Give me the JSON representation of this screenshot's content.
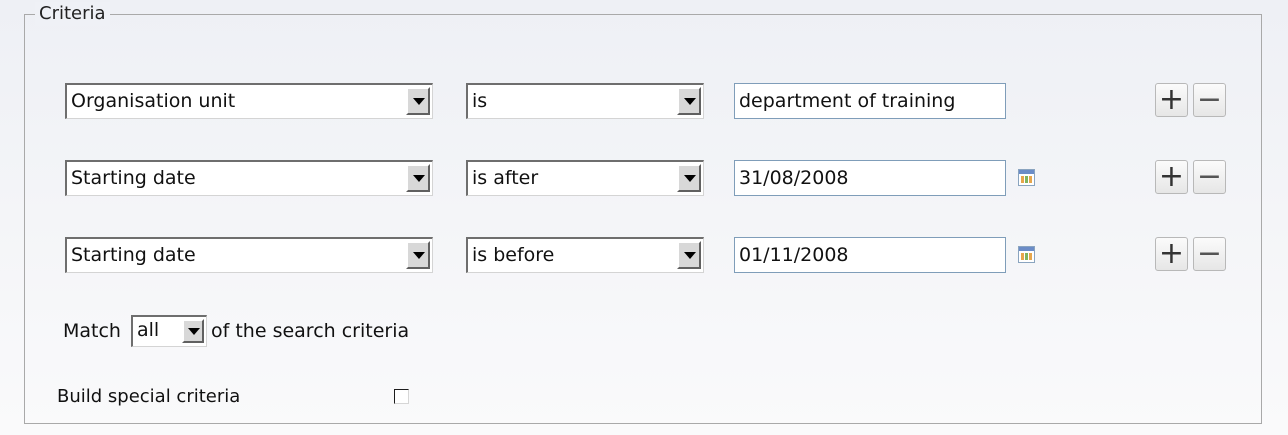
{
  "section": {
    "legend": "Criteria"
  },
  "rows": [
    {
      "field": "Organisation unit",
      "operator": "is",
      "value": "department of training",
      "has_calendar": false
    },
    {
      "field": "Starting date",
      "operator": "is after",
      "value": "31/08/2008",
      "has_calendar": true
    },
    {
      "field": "Starting date",
      "operator": "is before",
      "value": "01/11/2008",
      "has_calendar": true
    }
  ],
  "buttons": {
    "add": "+",
    "remove": "−"
  },
  "match": {
    "prefix": "Match",
    "selected": "all",
    "suffix": "of the search criteria"
  },
  "special": {
    "label": "Build special criteria",
    "checked": false
  },
  "icons": {
    "dropdown": "chevron-down-icon",
    "calendar": "calendar-icon"
  }
}
